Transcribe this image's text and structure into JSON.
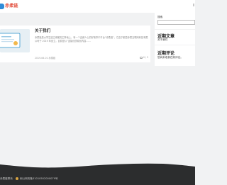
{
  "header": {
    "logo_text": "赤柔链"
  },
  "post": {
    "title": "关于我们",
    "excerpt": "赤柔链是大学生建立博客的主阵地上，有一个由威人心的好故事中平台“赤柔链”，它由宁都县赤柔互联网科技有限公司于 2019 年创立，目前是以“连接优质原创内容……",
    "date": "2019-06-01 赤柔链",
    "comments": "0 / 5"
  },
  "sidebar": {
    "search_label": "搜索",
    "search_placeholder": "",
    "recent_posts_title": "近期文章",
    "recent_posts": [
      "关于我们"
    ],
    "recent_comments_title": "近期评论",
    "no_comments_text": "您尚未收到任何评论。"
  },
  "footer": {
    "left_text": "赤柔链联系",
    "beian_text": "闽公网安备31010502000079号"
  },
  "colors": {
    "logo_blue": "#2e8bd8",
    "logo_red": "#e24c3a",
    "page_bg": "#f1f2f3",
    "footer_bg": "#2c2d2e"
  }
}
